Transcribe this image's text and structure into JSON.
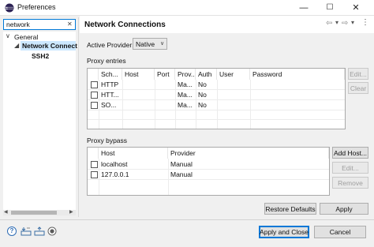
{
  "window": {
    "title": "Preferences",
    "min_glyph": "—",
    "max_glyph": "☐",
    "close_glyph": "✕"
  },
  "search": {
    "value": "network",
    "clear_glyph": "✕"
  },
  "tree": {
    "items": [
      {
        "label": "General",
        "expander": "∨"
      },
      {
        "label": "Network Connect",
        "expander": ""
      },
      {
        "label": "SSH2",
        "expander": ""
      }
    ]
  },
  "page": {
    "title": "Network Connections",
    "nav": {
      "back": "⇦",
      "back_menu": "▾",
      "fwd": "⇨",
      "fwd_menu": "▾",
      "view_menu": "⋮"
    }
  },
  "provider": {
    "label": "Active Provider:",
    "selected": "Native",
    "arrow": "∨"
  },
  "proxy_entries": {
    "label": "Proxy entries",
    "columns": [
      "Sch...",
      "Host",
      "Port",
      "Prov...",
      "Auth",
      "User",
      "Password"
    ],
    "rows": [
      [
        "HTTP",
        "",
        "",
        "Ma...",
        "No",
        "",
        ""
      ],
      [
        "HTT...",
        "",
        "",
        "Ma...",
        "No",
        "",
        ""
      ],
      [
        "SO...",
        "",
        "",
        "Ma...",
        "No",
        "",
        ""
      ]
    ],
    "buttons": {
      "edit": "Edit...",
      "clear": "Clear"
    }
  },
  "proxy_bypass": {
    "label": "Proxy bypass",
    "columns": [
      "Host",
      "Provider"
    ],
    "rows": [
      [
        "localhost",
        "Manual"
      ],
      [
        "127.0.0.1",
        "Manual"
      ]
    ],
    "buttons": {
      "add": "Add Host...",
      "edit": "Edit...",
      "remove": "Remove"
    }
  },
  "actions": {
    "restore": "Restore Defaults",
    "apply": "Apply"
  },
  "footer": {
    "apply_close": "Apply and Close",
    "cancel": "Cancel"
  },
  "icons": {
    "help": "?",
    "import": "import-icon",
    "export": "export-icon",
    "record": "record-icon"
  },
  "colors": {
    "accent": "#0078d7",
    "selection": "#cce8ff"
  }
}
